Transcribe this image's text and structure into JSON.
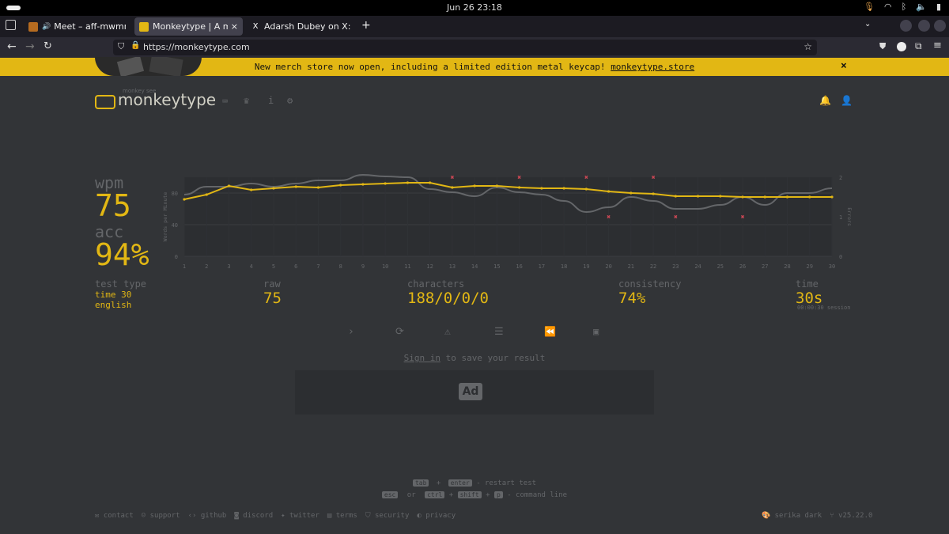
{
  "system": {
    "clock": "Jun 26  23:18"
  },
  "browser": {
    "tabs": [
      {
        "label": "Meet – aff-mwmm-rcq",
        "muted_icon": "🔊",
        "close": "×"
      },
      {
        "label": "Monkeytype | A minimalis",
        "close": "×"
      },
      {
        "label": "Adarsh Dubey on X: \"man",
        "close": "×"
      }
    ],
    "new_tab": "+",
    "url": "https://monkeytype.com"
  },
  "banner": {
    "text": "New merch store now open, including a limited edition metal keycap! ",
    "link": "monkeytype.store",
    "close": "×"
  },
  "header": {
    "logo_small": "monkey see",
    "logo": "monkeytype"
  },
  "result": {
    "wpm_label": "wpm",
    "wpm": "75",
    "acc_label": "acc",
    "acc": "94%",
    "test_type_label": "test type",
    "test_type_1": "time 30",
    "test_type_2": "english",
    "raw_label": "raw",
    "raw": "75",
    "characters_label": "characters",
    "characters": "188/0/0/0",
    "consistency_label": "consistency",
    "consistency": "74%",
    "time_label": "time",
    "time": "30s",
    "session": "00:00:30 session"
  },
  "chart_data": {
    "type": "line",
    "x": [
      1,
      2,
      3,
      4,
      5,
      6,
      7,
      8,
      9,
      10,
      11,
      12,
      13,
      14,
      15,
      16,
      17,
      18,
      19,
      20,
      21,
      22,
      23,
      24,
      25,
      26,
      27,
      28,
      29,
      30
    ],
    "ylabel": "Words per Minute",
    "y2label": "Errors",
    "ylim": [
      0,
      100
    ],
    "y2lim": [
      0,
      2
    ],
    "yticks": [
      "0",
      "40",
      "80"
    ],
    "y2ticks": [
      "0",
      "1",
      "2"
    ],
    "series": [
      {
        "values": [
          72,
          78,
          89,
          84,
          86,
          88,
          87,
          90,
          91,
          92,
          93,
          93,
          87,
          89,
          89,
          87,
          86,
          86,
          85,
          82,
          80,
          79,
          76,
          76,
          76,
          75,
          75,
          75,
          75,
          75
        ]
      },
      {
        "values": [
          78,
          88,
          88,
          92,
          88,
          92,
          96,
          96,
          103,
          101,
          100,
          85,
          81,
          76,
          87,
          81,
          78,
          70,
          56,
          62,
          75,
          70,
          60,
          60,
          65,
          75,
          65,
          80,
          80,
          86
        ]
      },
      {
        "values": [
          null,
          null,
          null,
          null,
          null,
          null,
          null,
          null,
          null,
          null,
          null,
          null,
          2,
          null,
          null,
          2,
          null,
          null,
          2,
          1,
          null,
          2,
          1,
          null,
          null,
          1,
          null,
          null,
          null,
          null
        ]
      }
    ],
    "colors": {
      "wpm": "#e2b714",
      "raw": "#646669",
      "errors": "#ca4754"
    }
  },
  "actions": [
    "next-test-icon",
    "restart-icon",
    "report-icon",
    "words-history-icon",
    "replay-icon",
    "screenshot-icon"
  ],
  "signin": {
    "link": "Sign in",
    "text": " to save your result"
  },
  "ad": {
    "label": "Ad"
  },
  "shortcuts": {
    "tab": "tab",
    "plus": "+",
    "enter": "enter",
    "restart": " - restart test",
    "esc": "esc",
    "or": "or",
    "ctrl": "ctrl",
    "shift": "shift",
    "p": "p",
    "command": " - command line"
  },
  "footer": {
    "links": [
      "contact",
      "support",
      "github",
      "discord",
      "twitter",
      "terms",
      "security",
      "privacy"
    ],
    "theme": "serika dark",
    "version": "v25.22.0"
  }
}
